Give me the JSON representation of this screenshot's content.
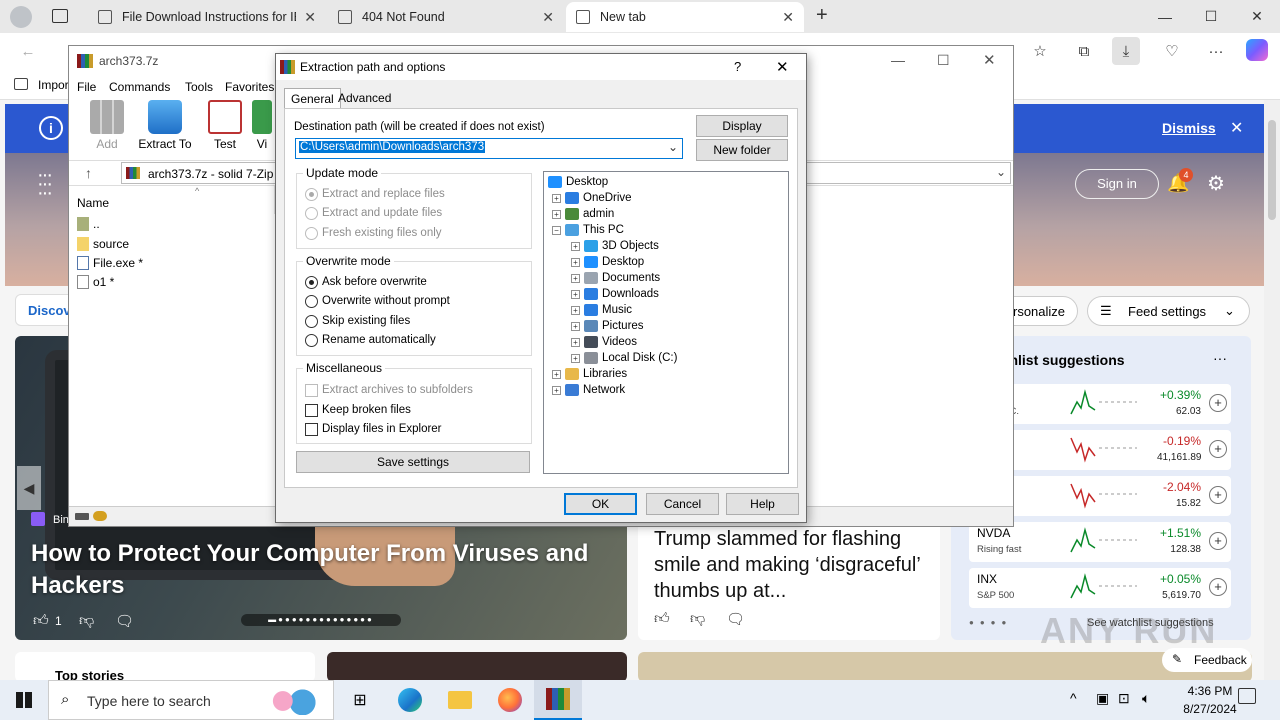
{
  "browser": {
    "tabs": [
      {
        "title": "File Download Instructions for IE(",
        "close": "✕",
        "active": false
      },
      {
        "title": "404 Not Found",
        "close": "✕",
        "active": false
      },
      {
        "title": "New tab",
        "close": "✕",
        "active": true
      }
    ],
    "new_tab_label": "+",
    "favorites_label": "Impor",
    "window_controls": {
      "minimize": "—",
      "maximize": "☐",
      "close": "✕"
    }
  },
  "page": {
    "banner": {
      "dismiss_label": "Dismiss",
      "info_icon": "i",
      "close": "✕"
    },
    "header": {
      "sign_in_label": "Sign in",
      "notification_count": "4"
    },
    "left_pill": "Discov",
    "personalize_label": "rsonalize",
    "feed_settings_label": "Feed settings",
    "hero_story": {
      "source": "Bing",
      "title": "How to Protect Your Computer From Viruses and Hackers",
      "like_count": "1"
    },
    "mid_story": {
      "title": "Trump slammed for flashing smile and making ‘disgraceful’ thumbs up at..."
    },
    "watchlist": {
      "title": "tchlist suggestions",
      "more": "···",
      "rows": [
        {
          "symbol": "",
          "sub": "OUP INC.",
          "change": "+0.39%",
          "price": "62.03",
          "trend": "up"
        },
        {
          "symbol": "",
          "sub": "",
          "change": "-0.19%",
          "price": "41,161.89",
          "trend": "down"
        },
        {
          "symbol": "",
          "sub": "ng fast",
          "change": "-2.04%",
          "price": "15.82",
          "trend": "down"
        },
        {
          "symbol": "NVDA",
          "sub": "Rising fast",
          "change": "+1.51%",
          "price": "128.38",
          "trend": "up"
        },
        {
          "symbol": "INX",
          "sub": "S&P 500",
          "change": "+0.05%",
          "price": "5,619.70",
          "trend": "up"
        }
      ],
      "see_more": "See watchlist suggestions"
    },
    "top_stories_label": "Top stories",
    "feedback_label": "Feedback",
    "watermark": "ANY RUN"
  },
  "rar": {
    "title": "arch373.7z",
    "menu": [
      "File",
      "Commands",
      "Tools",
      "Favorites"
    ],
    "toolbar": [
      {
        "label": "Add",
        "disabled": true
      },
      {
        "label": "Extract To",
        "disabled": false
      },
      {
        "label": "Test",
        "disabled": false
      },
      {
        "label": "Vi",
        "disabled": false
      }
    ],
    "path_text": "arch373.7z - solid 7-Zip a",
    "column_name": "Name",
    "files": [
      {
        "name": ".."
      },
      {
        "name": "source"
      },
      {
        "name": "File.exe *"
      },
      {
        "name": "o1 *"
      }
    ]
  },
  "dialog": {
    "title": "Extraction path and options",
    "help": "?",
    "close": "✕",
    "tabs": [
      "General",
      "Advanced"
    ],
    "dest_label": "Destination path (will be created if does not exist)",
    "dest_value": "C:\\Users\\admin\\Downloads\\arch373",
    "display_btn": "Display",
    "new_folder_btn": "New folder",
    "update_mode": {
      "title": "Update mode",
      "options": [
        "Extract and replace files",
        "Extract and update files",
        "Fresh existing files only"
      ],
      "selected": 0,
      "disabled": true
    },
    "overwrite_mode": {
      "title": "Overwrite mode",
      "options": [
        "Ask before overwrite",
        "Overwrite without prompt",
        "Skip existing files",
        "Rename automatically"
      ],
      "selected": 0
    },
    "misc": {
      "title": "Miscellaneous",
      "options": [
        {
          "label": "Extract archives to subfolders",
          "checked": false,
          "disabled": true
        },
        {
          "label": "Keep broken files",
          "checked": false,
          "disabled": false
        },
        {
          "label": "Display files in Explorer",
          "checked": false,
          "disabled": false
        }
      ]
    },
    "save_settings_btn": "Save settings",
    "tree": [
      {
        "label": "Desktop",
        "depth": 0,
        "expander": "",
        "icon": "#1e90ff"
      },
      {
        "label": "OneDrive",
        "depth": 1,
        "expander": "+",
        "icon": "#2a7de1"
      },
      {
        "label": "admin",
        "depth": 1,
        "expander": "+",
        "icon": "#4a8a3a"
      },
      {
        "label": "This PC",
        "depth": 1,
        "expander": "−",
        "icon": "#4aa0e0"
      },
      {
        "label": "3D Objects",
        "depth": 2,
        "expander": "+",
        "icon": "#2ba0e8"
      },
      {
        "label": "Desktop",
        "depth": 2,
        "expander": "+",
        "icon": "#1e90ff"
      },
      {
        "label": "Documents",
        "depth": 2,
        "expander": "+",
        "icon": "#9aa4b0"
      },
      {
        "label": "Downloads",
        "depth": 2,
        "expander": "+",
        "icon": "#2a7de1"
      },
      {
        "label": "Music",
        "depth": 2,
        "expander": "+",
        "icon": "#2a7de1"
      },
      {
        "label": "Pictures",
        "depth": 2,
        "expander": "+",
        "icon": "#5a88b8"
      },
      {
        "label": "Videos",
        "depth": 2,
        "expander": "+",
        "icon": "#444c58"
      },
      {
        "label": "Local Disk (C:)",
        "depth": 2,
        "expander": "+",
        "icon": "#8a8f98"
      },
      {
        "label": "Libraries",
        "depth": 1,
        "expander": "+",
        "icon": "#e8b84a"
      },
      {
        "label": "Network",
        "depth": 1,
        "expander": "+",
        "icon": "#3a7bd5"
      }
    ],
    "ok_btn": "OK",
    "cancel_btn": "Cancel",
    "help_btn": "Help"
  },
  "taskbar": {
    "search_placeholder": "Type here to search",
    "time": "4:36 PM",
    "date": "8/27/2024"
  },
  "colors": {
    "accent": "#0078d7",
    "banner": "#2b58d0",
    "up": "#0a8a2a",
    "down": "#c62828"
  }
}
